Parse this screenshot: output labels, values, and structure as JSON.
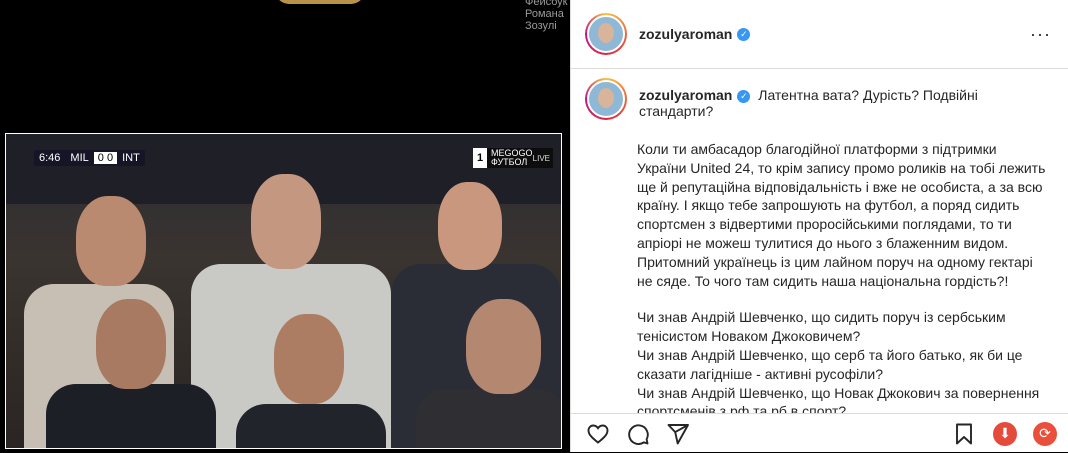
{
  "top": {
    "cut_text": "Фейсбук Романа Зозулі"
  },
  "video": {
    "hud_time": "6:46",
    "hud_home": "MIL",
    "hud_score": "0 0",
    "hud_away": "INT",
    "channel_number": "1",
    "channel_brand": "MEGOGO",
    "channel_sub": "ФУТБОЛ",
    "live_label": "LIVE"
  },
  "post": {
    "username": "zozulyaroman",
    "verified_mark": "✓",
    "more_label": "···",
    "caption_title": "Латентна вата? Дурість? Подвійні стандарти?",
    "paragraphs": [
      "Коли ти амбасадор благодійної платформи з підтримки України United 24, то крім запису промо роликів на тобі лежить ще й репутаційна відповідальність і вже не особиста, а за всю країну. І якщо тебе запрошують на футбол, а поряд сидить спортсмен з відвертими проросійськими поглядами, то ти апріорі не можеш тулитися до нього з блаженним видом. Притомний українець із цим лайном поруч на одному гектарі не сяде. То чого там сидить наша національна гордість?!",
      "Чи знав Андрій Шевченко, що сидить поруч із сербським тенісистом Новаком Джоковичем?\nЧи знав Андрій Шевченко, що серб та його батько, як би це сказати лагідніше - активні русофіли?\nЧи знав Андрій Шевченко, що Новак Джокович за повернення спортсменів з рф та рб в спорт?"
    ]
  },
  "actions": {
    "download_glyph": "⬇",
    "repost_glyph": "⟳"
  }
}
